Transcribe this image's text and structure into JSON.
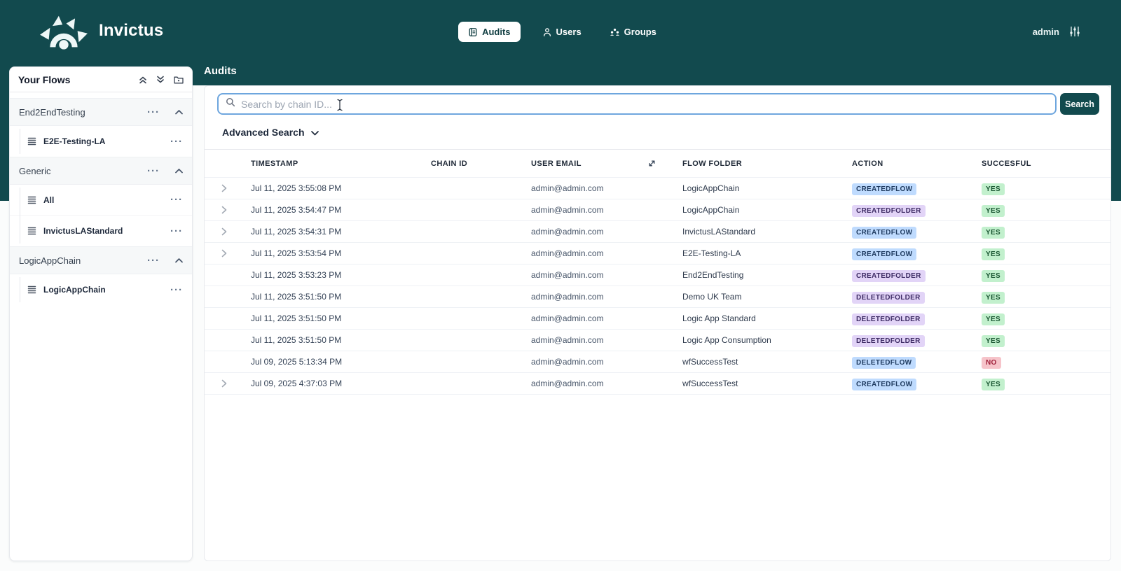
{
  "colors": {
    "teal": "#124a4e",
    "badge_flow_bg": "#bfdbfe",
    "badge_folder_bg": "#e2d4f7",
    "badge_yes_bg": "#c2f0cd",
    "badge_no_bg": "#f6c4ca"
  },
  "header": {
    "brand": "Invictus",
    "nav": [
      {
        "label": "Audits",
        "active": true
      },
      {
        "label": "Users",
        "active": false
      },
      {
        "label": "Groups",
        "active": false
      }
    ],
    "username": "admin"
  },
  "sidebar": {
    "title": "Your Flows",
    "groups": [
      {
        "label": "End2EndTesting",
        "items": [
          {
            "label": "E2E-Testing-LA"
          }
        ]
      },
      {
        "label": "Generic",
        "items": [
          {
            "label": "All"
          },
          {
            "label": "InvictusLAStandard"
          }
        ]
      },
      {
        "label": "LogicAppChain",
        "items": [
          {
            "label": "LogicAppChain"
          }
        ]
      }
    ]
  },
  "main": {
    "page_title": "Audits",
    "search": {
      "placeholder": "Search by chain ID...",
      "value": "",
      "button_label": "Search"
    },
    "advanced_search_label": "Advanced Search",
    "table": {
      "columns": [
        "TIMESTAMP",
        "CHAIN ID",
        "USER EMAIL",
        "FLOW FOLDER",
        "ACTION",
        "SUCCESFUL"
      ],
      "rows": [
        {
          "expandable": true,
          "timestamp": "Jul 11, 2025 3:55:08 PM",
          "chain_id": "",
          "user_email": "admin@admin.com",
          "flow_folder": "LogicAppChain",
          "action": "CREATEDFLOW",
          "successful": "YES"
        },
        {
          "expandable": true,
          "timestamp": "Jul 11, 2025 3:54:47 PM",
          "chain_id": "",
          "user_email": "admin@admin.com",
          "flow_folder": "LogicAppChain",
          "action": "CREATEDFOLDER",
          "successful": "YES"
        },
        {
          "expandable": true,
          "timestamp": "Jul 11, 2025 3:54:31 PM",
          "chain_id": "",
          "user_email": "admin@admin.com",
          "flow_folder": "InvictusLAStandard",
          "action": "CREATEDFLOW",
          "successful": "YES"
        },
        {
          "expandable": true,
          "timestamp": "Jul 11, 2025 3:53:54 PM",
          "chain_id": "",
          "user_email": "admin@admin.com",
          "flow_folder": "E2E-Testing-LA",
          "action": "CREATEDFLOW",
          "successful": "YES"
        },
        {
          "expandable": false,
          "timestamp": "Jul 11, 2025 3:53:23 PM",
          "chain_id": "",
          "user_email": "admin@admin.com",
          "flow_folder": "End2EndTesting",
          "action": "CREATEDFOLDER",
          "successful": "YES"
        },
        {
          "expandable": false,
          "timestamp": "Jul 11, 2025 3:51:50 PM",
          "chain_id": "",
          "user_email": "admin@admin.com",
          "flow_folder": "Demo UK Team",
          "action": "DELETEDFOLDER",
          "successful": "YES"
        },
        {
          "expandable": false,
          "timestamp": "Jul 11, 2025 3:51:50 PM",
          "chain_id": "",
          "user_email": "admin@admin.com",
          "flow_folder": "Logic App Standard",
          "action": "DELETEDFOLDER",
          "successful": "YES"
        },
        {
          "expandable": false,
          "timestamp": "Jul 11, 2025 3:51:50 PM",
          "chain_id": "",
          "user_email": "admin@admin.com",
          "flow_folder": "Logic App Consumption",
          "action": "DELETEDFOLDER",
          "successful": "YES"
        },
        {
          "expandable": false,
          "timestamp": "Jul 09, 2025 5:13:34 PM",
          "chain_id": "",
          "user_email": "admin@admin.com",
          "flow_folder": "wfSuccessTest",
          "action": "DELETEDFLOW",
          "successful": "NO"
        },
        {
          "expandable": true,
          "timestamp": "Jul 09, 2025 4:37:03 PM",
          "chain_id": "",
          "user_email": "admin@admin.com",
          "flow_folder": "wfSuccessTest",
          "action": "CREATEDFLOW",
          "successful": "YES"
        }
      ]
    }
  }
}
